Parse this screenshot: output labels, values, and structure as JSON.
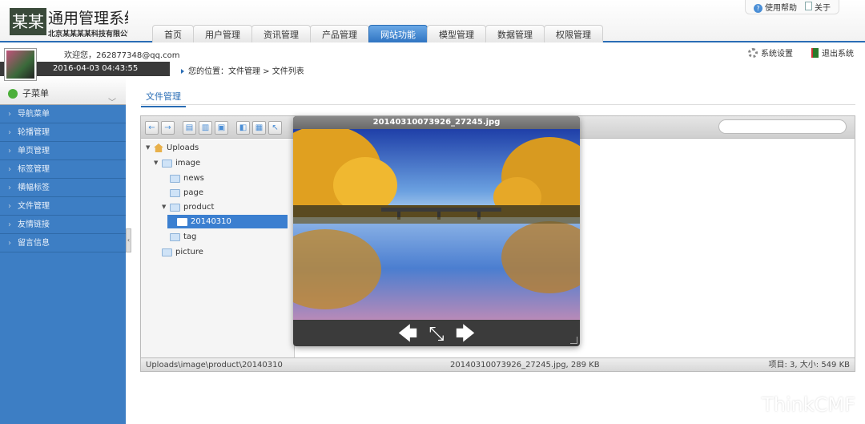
{
  "header": {
    "logo_mark": "某某",
    "logo_title": "通用管理系统",
    "logo_subtitle": "北京某某某某科技有限公司",
    "help_label": "使用帮助",
    "about_label": "关于",
    "nav": [
      "首页",
      "用户管理",
      "资讯管理",
      "产品管理",
      "网站功能",
      "模型管理",
      "数据管理",
      "权限管理"
    ],
    "active_nav": "网站功能"
  },
  "userbar": {
    "welcome": "欢迎您，262877348@qq.com",
    "datetime": "2016-04-03 04:43:55",
    "settings_label": "系统设置",
    "logout_label": "退出系统",
    "breadcrumb": "您的位置：文件管理 > 文件列表"
  },
  "sidebar": {
    "header": "子菜单",
    "items": [
      "导航菜单",
      "轮播管理",
      "单页管理",
      "标签管理",
      "横幅标签",
      "文件管理",
      "友情链接",
      "留言信息"
    ]
  },
  "main": {
    "tab": "文件管理"
  },
  "filemanager": {
    "tree": {
      "root": "Uploads",
      "image": "image",
      "news": "news",
      "page": "page",
      "product": "product",
      "selected": "20140310",
      "tag": "tag",
      "picture": "picture"
    },
    "status_path": "Uploads\\image\\product\\20140310",
    "status_file": "20140310073926_27245.jpg, 289 KB",
    "status_summary": "项目: 3, 大小: 549 KB"
  },
  "preview": {
    "title": "20140310073926_27245.jpg",
    "prev_glyph": "🡄",
    "fullscreen_glyph": "⤡",
    "next_glyph": "🡆"
  },
  "watermark": "ThinkCMF",
  "colors": {
    "accent": "#2a6db5",
    "sidebar": "#3d7ec4",
    "selected": "#3b7fd0"
  }
}
